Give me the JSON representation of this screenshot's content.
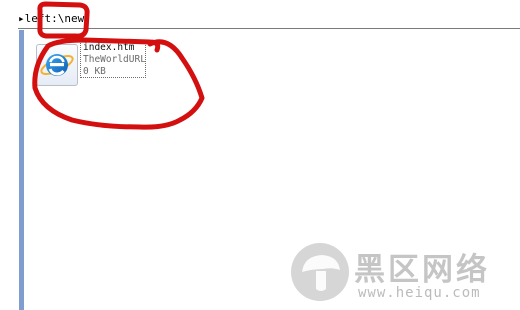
{
  "address_bar": {
    "path": "▸left:\\new"
  },
  "file": {
    "name": "index.htm",
    "type": "TheWorldURL",
    "size": "0 KB",
    "icon": "internet-explorer-icon"
  },
  "colors": {
    "annotation": "#d40f0f",
    "sidebar": "#7f9ecf",
    "watermark": "#969696"
  },
  "watermark": {
    "title": "黑区网络",
    "url": "www.heiqu.com"
  }
}
